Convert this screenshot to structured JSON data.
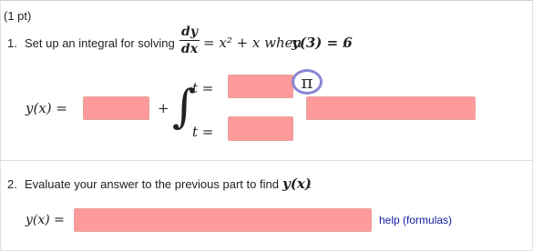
{
  "points": "(1 pt)",
  "q1": {
    "number": "1.",
    "prompt": "Set up an integral for solving",
    "dy": "dy",
    "dx": "dx",
    "equation_rest": "= x² + x when ",
    "condition": "y(3) = 6",
    "period": ".",
    "lhs": "y(x) =",
    "plus": "+",
    "t_upper": "t =",
    "t_lower": "t =",
    "pi_label": "π"
  },
  "q2": {
    "number": "2.",
    "prompt": "Evaluate your answer to the previous part to find ",
    "target": "y(x)",
    "period": ".",
    "lhs": "y(x) =",
    "help_link": "help (formulas)"
  },
  "colors": {
    "input_fill": "#ff9a9a",
    "pi_ring": "#8a86d6",
    "link": "#0f1aa0"
  }
}
